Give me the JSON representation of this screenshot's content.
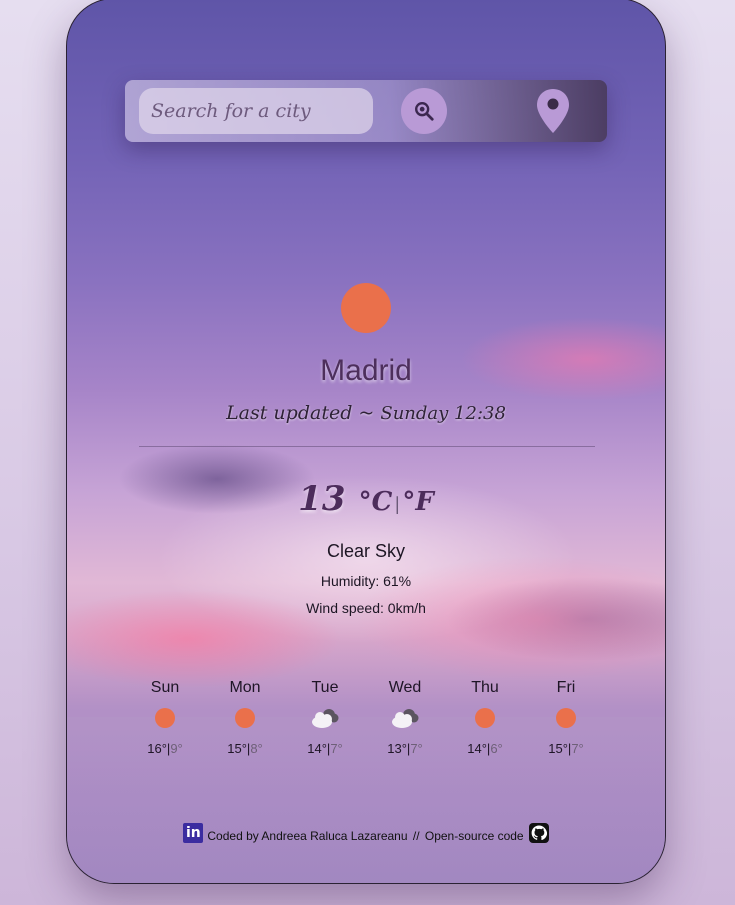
{
  "search": {
    "placeholder": "Search for a city",
    "value": ""
  },
  "icons": {
    "search_button": "magnifier-icon",
    "location_button": "map-pin-icon",
    "current_weather": "sun-icon",
    "linkedin": "linkedin-icon",
    "github": "github-icon"
  },
  "current": {
    "city": "Madrid",
    "last_updated_label": "Last updated ~",
    "last_updated_value": "Sunday 12:38",
    "temperature": "13",
    "unit_celsius": "°C",
    "unit_separator": "|",
    "unit_fahrenheit": "°F",
    "description": "Clear Sky",
    "humidity": "Humidity: 61%",
    "wind": "Wind speed: 0km/h"
  },
  "forecast": [
    {
      "day": "Sun",
      "icon": "sun-icon",
      "max": "16°",
      "min": "9°"
    },
    {
      "day": "Mon",
      "icon": "sun-icon",
      "max": "15°",
      "min": "8°"
    },
    {
      "day": "Tue",
      "icon": "cloud-icon",
      "max": "14°",
      "min": "7°"
    },
    {
      "day": "Wed",
      "icon": "cloud-icon",
      "max": "13°",
      "min": "7°"
    },
    {
      "day": "Thu",
      "icon": "sun-icon",
      "max": "14°",
      "min": "6°"
    },
    {
      "day": "Fri",
      "icon": "sun-icon",
      "max": "15°",
      "min": "7°"
    }
  ],
  "footer": {
    "linkedin_badge": "in",
    "coded_by": "Coded by Andreea Raluca Lazareanu",
    "separator": " // ",
    "open_source": "Open-source code"
  },
  "colors": {
    "accent_sun": "#ea704b",
    "search_button": "#b99ad6",
    "city_text": "#4d2f5c"
  }
}
